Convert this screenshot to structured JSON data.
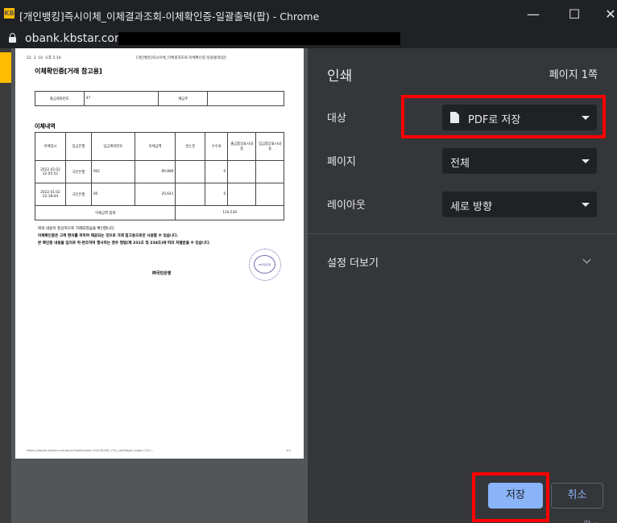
{
  "window": {
    "title": "[개인뱅킹]즉시이체_이체결과조회-이체확인증-일괄출력(팝) - Chrome",
    "logo": "KB",
    "url": "obank.kbstar.com",
    "controls": {
      "minimize": "—",
      "maximize": "☐",
      "close": "✕"
    }
  },
  "preview": {
    "header_left": "22. 3. 10. 오후 5:16",
    "header_center": "[개인뱅킹]즉시이체_이체결과조회-이체확인증-일괄출력(팝)",
    "doc_title": "이체확인증[거래 참고용]",
    "account_table": {
      "label1": "출금계좌번호",
      "value1": "47",
      "label2": "예금주",
      "value2": ""
    },
    "section_title": "이체내역",
    "columns": [
      "이체일시",
      "입금은행",
      "입금계좌번호",
      "이체금액",
      "받는분",
      "수수료",
      "출금통장표시내용",
      "입금통장표시내용"
    ],
    "rows": [
      {
        "date": "2022.02.02",
        "time": "22:05:52",
        "bank": "국민은행",
        "account": "002",
        "amount": "89,889",
        "receiver": "",
        "fee": "0",
        "memo_out": "",
        "memo_in": ""
      },
      {
        "date": "2022.01.02",
        "time": "22:18:04",
        "bank": "국민은행",
        "account": "00",
        "amount": "20,641",
        "receiver": "",
        "fee": "0",
        "memo_out": "",
        "memo_in": ""
      }
    ],
    "total_label": "이체금액 합계",
    "total_value": "110,530",
    "notes": [
      "위의 내용이 정상적으로 거래되었음을 확인합니다.",
      "이체확인증은 고객 편의를 위하여 제공되는 것으로 거래 참고용으로만 사용할 수 있습니다.",
      "본 확인증 내용을 임의로 위·변조하여 행사하는 경우 형법(제 231조 및 234조)에 따라 처벌받을 수 있습니다."
    ],
    "seal_text": "KB국민은행",
    "bank_name": "㈜국민은행",
    "footer_url": "https://obank.kbstar.com/quics?asfilecode=5023&QSL=F&_nextPage=page=C01...",
    "footer_page": "1/1"
  },
  "panel": {
    "title": "인쇄",
    "page_count": "페이지 1쪽",
    "destination_label": "대상",
    "destination_value": "PDF로 저장",
    "pages_label": "페이지",
    "pages_value": "전체",
    "layout_label": "레이아웃",
    "layout_value": "세로 방향",
    "more_settings": "설정 더보기",
    "save_button": "저장",
    "cancel_button": "취소",
    "bottom_partial": "람    ∨"
  },
  "colors": {
    "accent_button": "#8ab4f8",
    "highlight_box": "#ff0000",
    "panel_bg": "#35363a",
    "brand_yellow": "#ffbc00"
  },
  "icons": [
    "lock-icon",
    "doc-icon",
    "dropdown-arrow-icon",
    "chevron-down-icon",
    "minimize-icon",
    "maximize-icon",
    "close-icon"
  ]
}
